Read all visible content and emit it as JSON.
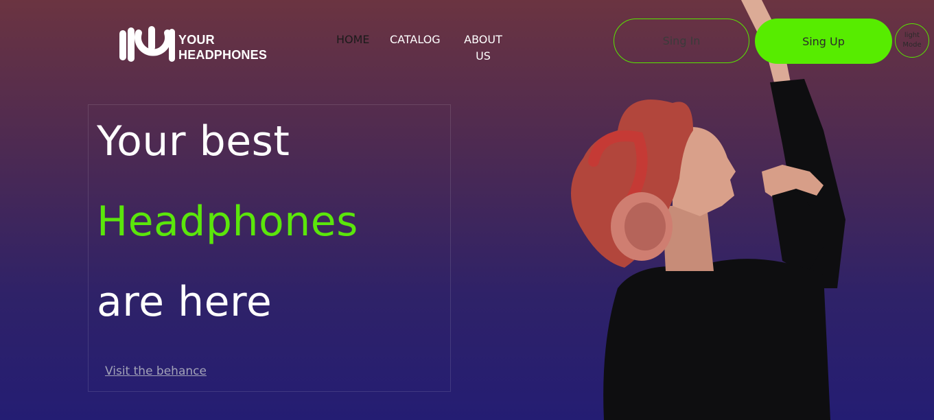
{
  "brand": {
    "name_line1": "YOUR",
    "name_line2": "HEADPHONES",
    "logo_icon": "headphones-logo-icon"
  },
  "nav": {
    "items": [
      {
        "label": "HOME"
      },
      {
        "label": "CATALOG"
      },
      {
        "label": "ABOUT US"
      }
    ]
  },
  "auth": {
    "signin_label": "Sing In",
    "signup_label": "Sing Up",
    "mode_line1": "light",
    "mode_line2": "Mode"
  },
  "hero": {
    "line1": "Your best",
    "line2": "Headphones",
    "line3": "are here",
    "link_label": "Visit the behance"
  },
  "colors": {
    "accent": "#57ec00",
    "bg_top": "#6b3441",
    "bg_bottom": "#241d73"
  }
}
